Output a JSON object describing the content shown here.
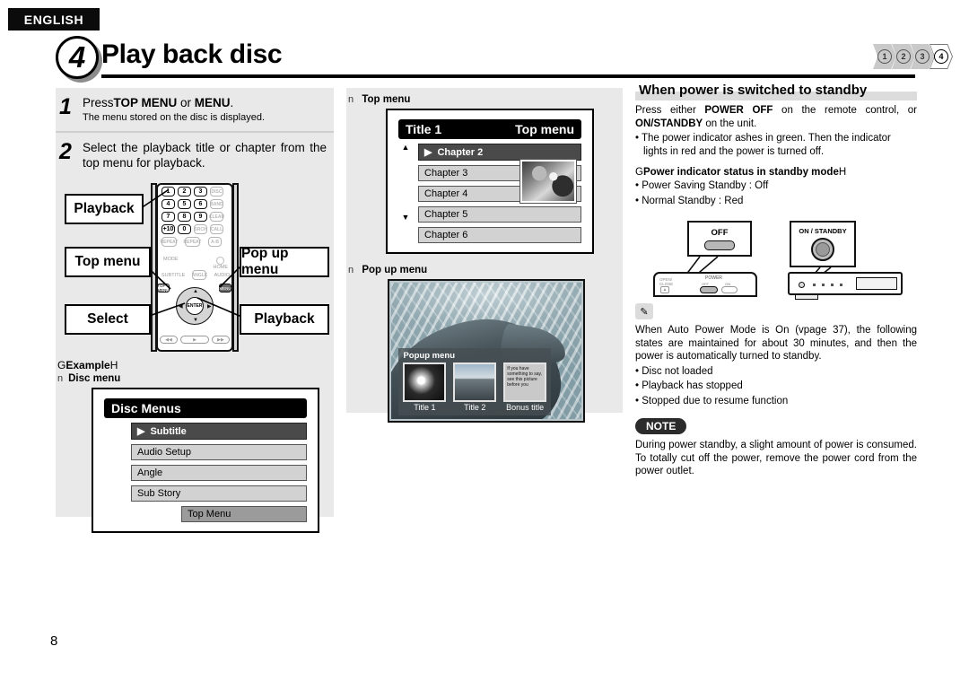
{
  "header": {
    "language_tab": "ENGLISH",
    "step_number": "4",
    "title": "Play back disc",
    "chapter_chips": [
      {
        "label": "1",
        "active": false
      },
      {
        "label": "2",
        "active": false
      },
      {
        "label": "3",
        "active": false
      },
      {
        "label": "4",
        "active": true
      }
    ]
  },
  "left": {
    "steps": [
      {
        "number": "1",
        "main_prefix": "Press",
        "main_bold1": "TOP MENU",
        "main_mid": " or ",
        "main_bold2": "MENU",
        "main_suffix": ".",
        "sub": "The menu stored on the disc is displayed."
      },
      {
        "number": "2",
        "text": "Select the playback title or chapter from the top menu for playback."
      }
    ],
    "remote_callouts": {
      "playback_top": "Playback",
      "top_menu": "Top menu",
      "pop_up_menu": "Pop up menu",
      "select": "Select",
      "playback_bottom": "Playback"
    },
    "remote_keys": {
      "row1": [
        "1",
        "2",
        "3",
        "DISC"
      ],
      "row2": [
        "4",
        "5",
        "6",
        "BAND"
      ],
      "row3": [
        "7",
        "8",
        "9",
        "CLEAR"
      ],
      "row4": [
        "+10",
        "0",
        "SRCH",
        "CALL"
      ],
      "row5": [
        "REPEAT",
        "REPEAT",
        "A-B"
      ],
      "mode": "MODE",
      "home": "HOME",
      "subtitle": "SUBTITLE",
      "angle": "ANGLE",
      "audio": "AUDIO",
      "top_menu_btn": "TOP MENU",
      "menu_btn": "MENU",
      "enter": "ENTER",
      "transport": [
        "◀◀",
        "▶",
        "▶▶"
      ]
    },
    "example_label_open": "G",
    "example_label_text": "Example",
    "example_label_close": "H",
    "disc_menu_heading_marker": "n",
    "disc_menu_heading": "Disc menu",
    "disc_menu": {
      "title": "Disc Menus",
      "items": [
        {
          "label": "Subtitle",
          "selected": true
        },
        {
          "label": "Audio Setup",
          "selected": false
        },
        {
          "label": "Angle",
          "selected": false
        },
        {
          "label": "Sub Story",
          "selected": false
        },
        {
          "label": "Top Menu",
          "selected": false,
          "indent": true
        }
      ],
      "cursor_glyph": "▶"
    }
  },
  "middle": {
    "top_menu_heading_marker": "n",
    "top_menu_heading": "Top menu",
    "top_menu_osd": {
      "title_left": "Title 1",
      "title_right": "Top menu",
      "scroll_up": "▲",
      "scroll_down": "▼",
      "cursor_glyph": "▶",
      "items": [
        {
          "label": "Chapter 2",
          "selected": true
        },
        {
          "label": "Chapter 3",
          "selected": false
        },
        {
          "label": "Chapter 4",
          "selected": false
        },
        {
          "label": "Chapter 5",
          "selected": false
        },
        {
          "label": "Chapter 6",
          "selected": false
        }
      ]
    },
    "pop_up_heading_marker": "n",
    "pop_up_heading": "Pop up menu",
    "pop_up_osd": {
      "bar_title": "Popup menu",
      "thumbs": [
        {
          "caption": "Title  1",
          "text": ""
        },
        {
          "caption": "Title  2",
          "text": ""
        },
        {
          "caption": "Bonus title",
          "text": "If you have something to say, see this picture before you"
        }
      ]
    }
  },
  "right": {
    "heading": "When power is switched to standby",
    "para1_a": "Press either ",
    "para1_b": "POWER OFF",
    "para1_c": " on the remote control, or  ",
    "para1_d": "ON/STANDBY",
    "para1_e": " on the unit.",
    "bullet1": "• The power indicator  ashes in green. Then the indicator lights in red and the power is turned off.",
    "sub_heading_open": "G",
    "sub_heading": "Power indicator status in standby mode",
    "sub_heading_close": "H",
    "status_bullets": [
      "• Power Saving Standby : Off",
      "• Normal Standby : Red"
    ],
    "remote_callout_label": "OFF",
    "remote_device_labels": {
      "open_close": "OPEN/CLOSE",
      "power": "POWER",
      "off": "OFF",
      "on": "ON"
    },
    "unit_callout_label": "ON / STANDBY",
    "pencil_icon": "✎",
    "tip_text": "When Auto Power Mode is On (vpage 37), the following states are maintained for about 30 minutes, and then the power is automatically turned to standby.",
    "tip_bullets": [
      "• Disc not loaded",
      "• Playback has stopped",
      "• Stopped due to resume function"
    ],
    "note_badge": "NOTE",
    "note_text": "During power standby, a slight amount of power is consumed. To totally cut off the power, remove the power cord from the power outlet."
  },
  "footer": {
    "page_number": "8"
  }
}
